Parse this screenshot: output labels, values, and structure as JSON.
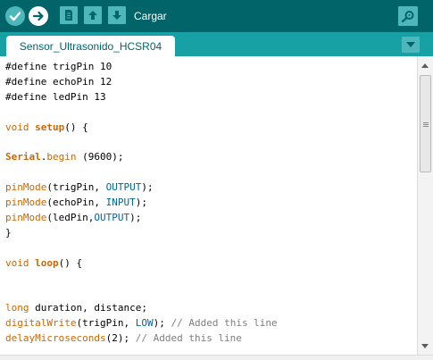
{
  "toolbar": {
    "upload_label": "Cargar",
    "icons": [
      "verify-icon",
      "upload-arrow-icon",
      "new-file-icon",
      "open-icon",
      "save-icon",
      "serial-monitor-icon"
    ],
    "colors": {
      "toolbar_bg": "#006468",
      "button_bg": "#4db7bb",
      "tabbar_bg": "#17a1a5"
    }
  },
  "tabs": [
    {
      "label": "Sensor_Ultrasonido_HCSR04"
    }
  ],
  "editor": {
    "lines": [
      "#define trigPin 10",
      "#define echoPin 12",
      "#define ledPin 13",
      "",
      "void setup() {",
      "",
      "Serial.begin (9600);",
      "",
      "pinMode(trigPin, OUTPUT);",
      "pinMode(echoPin, INPUT);",
      "pinMode(ledPin,OUTPUT);",
      "}",
      "",
      "void loop() {",
      "",
      "",
      "long duration, distance;",
      "digitalWrite(trigPin, LOW); // Added this line",
      "delayMicroseconds(2); // Added this line"
    ],
    "colors": {
      "keyword": "#cc6600",
      "constant": "#006699",
      "comment": "#7e7e7e"
    }
  }
}
